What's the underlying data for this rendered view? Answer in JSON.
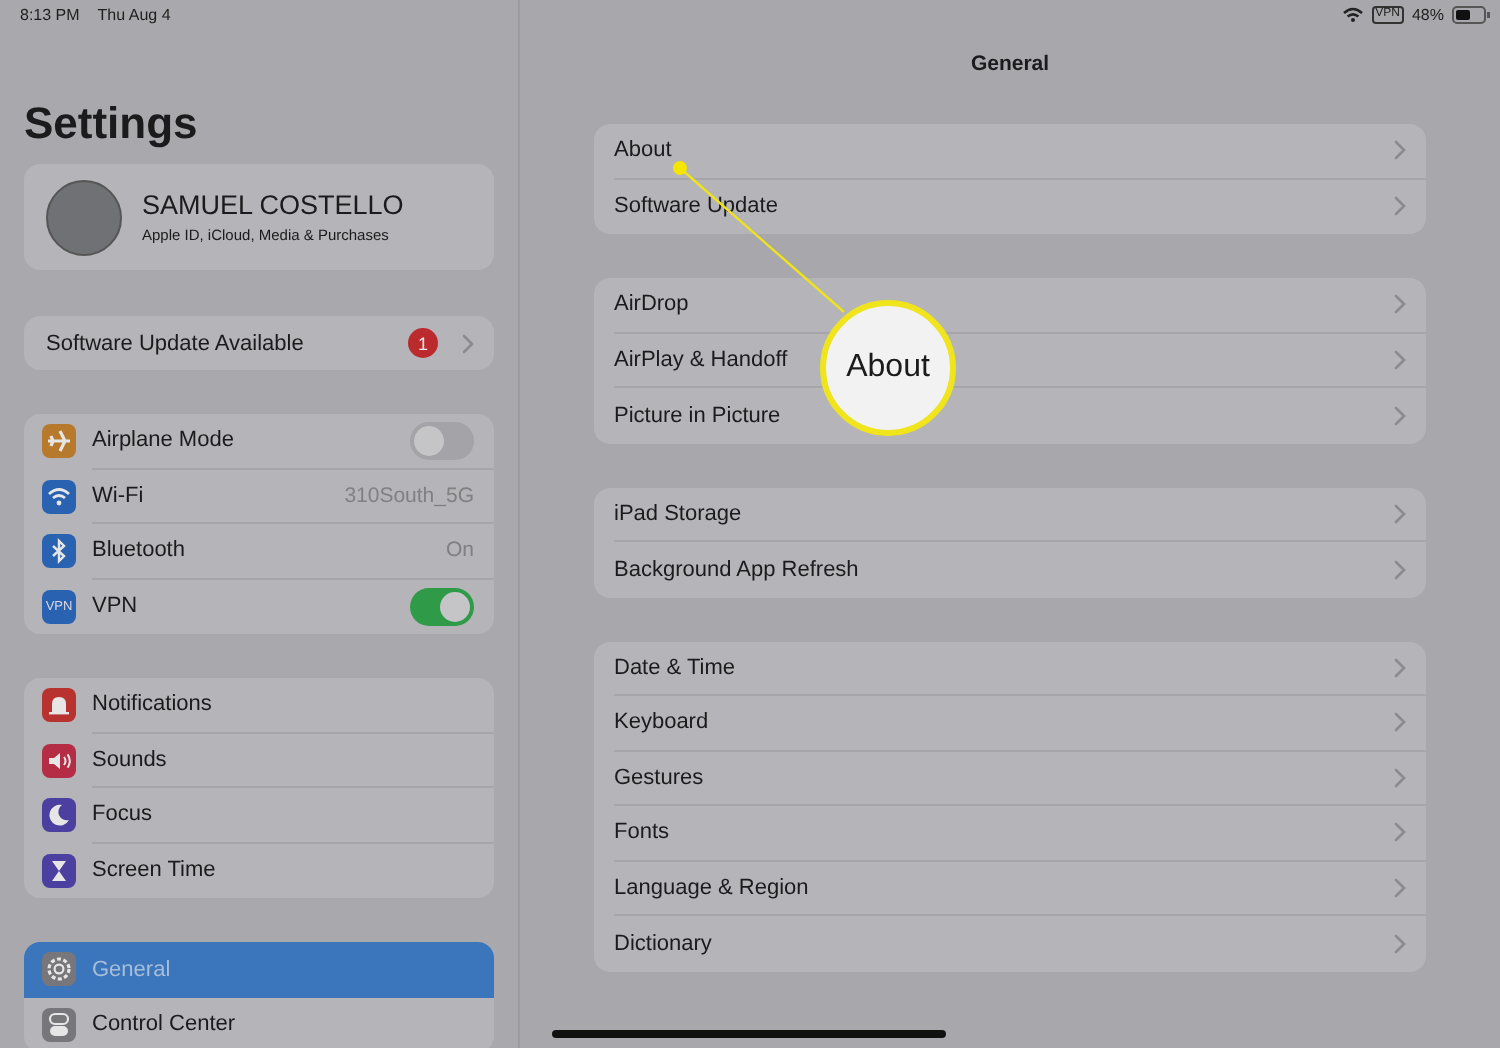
{
  "status_bar": {
    "time": "8:13 PM",
    "date": "Thu Aug 4",
    "vpn": "VPN",
    "battery": "48%"
  },
  "sidebar": {
    "title": "Settings",
    "profile": {
      "name": "SAMUEL COSTELLO",
      "subtitle": "Apple ID, iCloud, Media & Purchases"
    },
    "update_banner": {
      "label": "Software Update Available",
      "badge": "1"
    },
    "groups": [
      [
        {
          "label": "Airplane Mode",
          "kind": "toggle",
          "on": false,
          "color": "#b77a2c",
          "selected": false
        },
        {
          "label": "Wi-Fi",
          "kind": "value",
          "value": "310South_5G",
          "color": "#2a62b2",
          "selected": false
        },
        {
          "label": "Bluetooth",
          "kind": "value",
          "value": "On",
          "color": "#2a62b2",
          "selected": false
        },
        {
          "label": "VPN",
          "kind": "toggle",
          "on": true,
          "color": "#2a62b2",
          "icon_text": "VPN",
          "selected": false
        }
      ],
      [
        {
          "label": "Notifications",
          "kind": "plain",
          "color": "#b8332f",
          "selected": false
        },
        {
          "label": "Sounds",
          "kind": "plain",
          "color": "#b52d45",
          "selected": false
        },
        {
          "label": "Focus",
          "kind": "plain",
          "color": "#4b3fa0",
          "selected": false
        },
        {
          "label": "Screen Time",
          "kind": "plain",
          "color": "#4b3fa0",
          "selected": false
        }
      ],
      [
        {
          "label": "General",
          "kind": "plain",
          "color": "#77767a",
          "selected": true
        },
        {
          "label": "Control Center",
          "kind": "plain",
          "color": "#77767a",
          "selected": false
        }
      ]
    ]
  },
  "detail": {
    "title": "General",
    "groups": [
      [
        "About",
        "Software Update"
      ],
      [
        "AirDrop",
        "AirPlay & Handoff",
        "Picture in Picture"
      ],
      [
        "iPad Storage",
        "Background App Refresh"
      ],
      [
        "Date & Time",
        "Keyboard",
        "Gestures",
        "Fonts",
        "Language & Region",
        "Dictionary"
      ]
    ]
  },
  "callout": {
    "label": "About"
  }
}
